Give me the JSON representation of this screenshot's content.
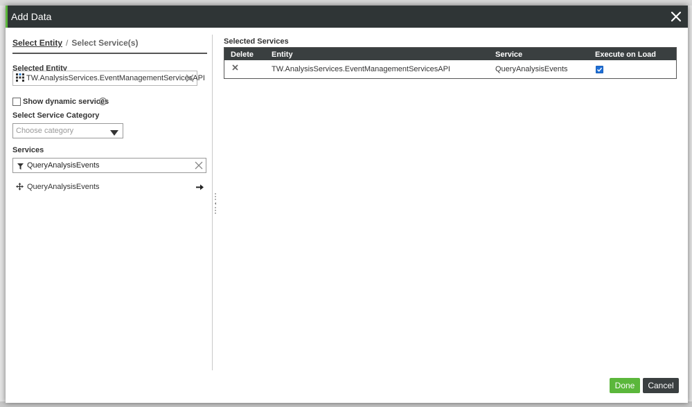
{
  "dialog": {
    "title": "Add Data",
    "accent_color": "#5bb73b",
    "titlebar_color": "#2f3536"
  },
  "left": {
    "steps": {
      "step1": "Select Entity",
      "separator": "/",
      "step2": "Select Service(s)"
    },
    "selected_entity_label": "Selected Entity",
    "selected_entity_value": "TW.AnalysisServices.EventManagementServicesAPI",
    "show_dynamic_label": "Show dynamic services",
    "show_dynamic_checked": false,
    "category_label": "Select Service Category",
    "category_placeholder": "Choose category",
    "services_label": "Services",
    "services_filter_value": "QueryAnalysisEvents",
    "services_list": [
      {
        "name": "QueryAnalysisEvents"
      }
    ]
  },
  "right": {
    "title": "Selected Services",
    "columns": {
      "delete": "Delete",
      "entity": "Entity",
      "service": "Service",
      "execute": "Execute on Load"
    },
    "rows": [
      {
        "entity": "TW.AnalysisServices.EventManagementServicesAPI",
        "service": "QueryAnalysisEvents",
        "execute_on_load": true
      }
    ]
  },
  "footer": {
    "done_label": "Done",
    "cancel_label": "Cancel"
  }
}
